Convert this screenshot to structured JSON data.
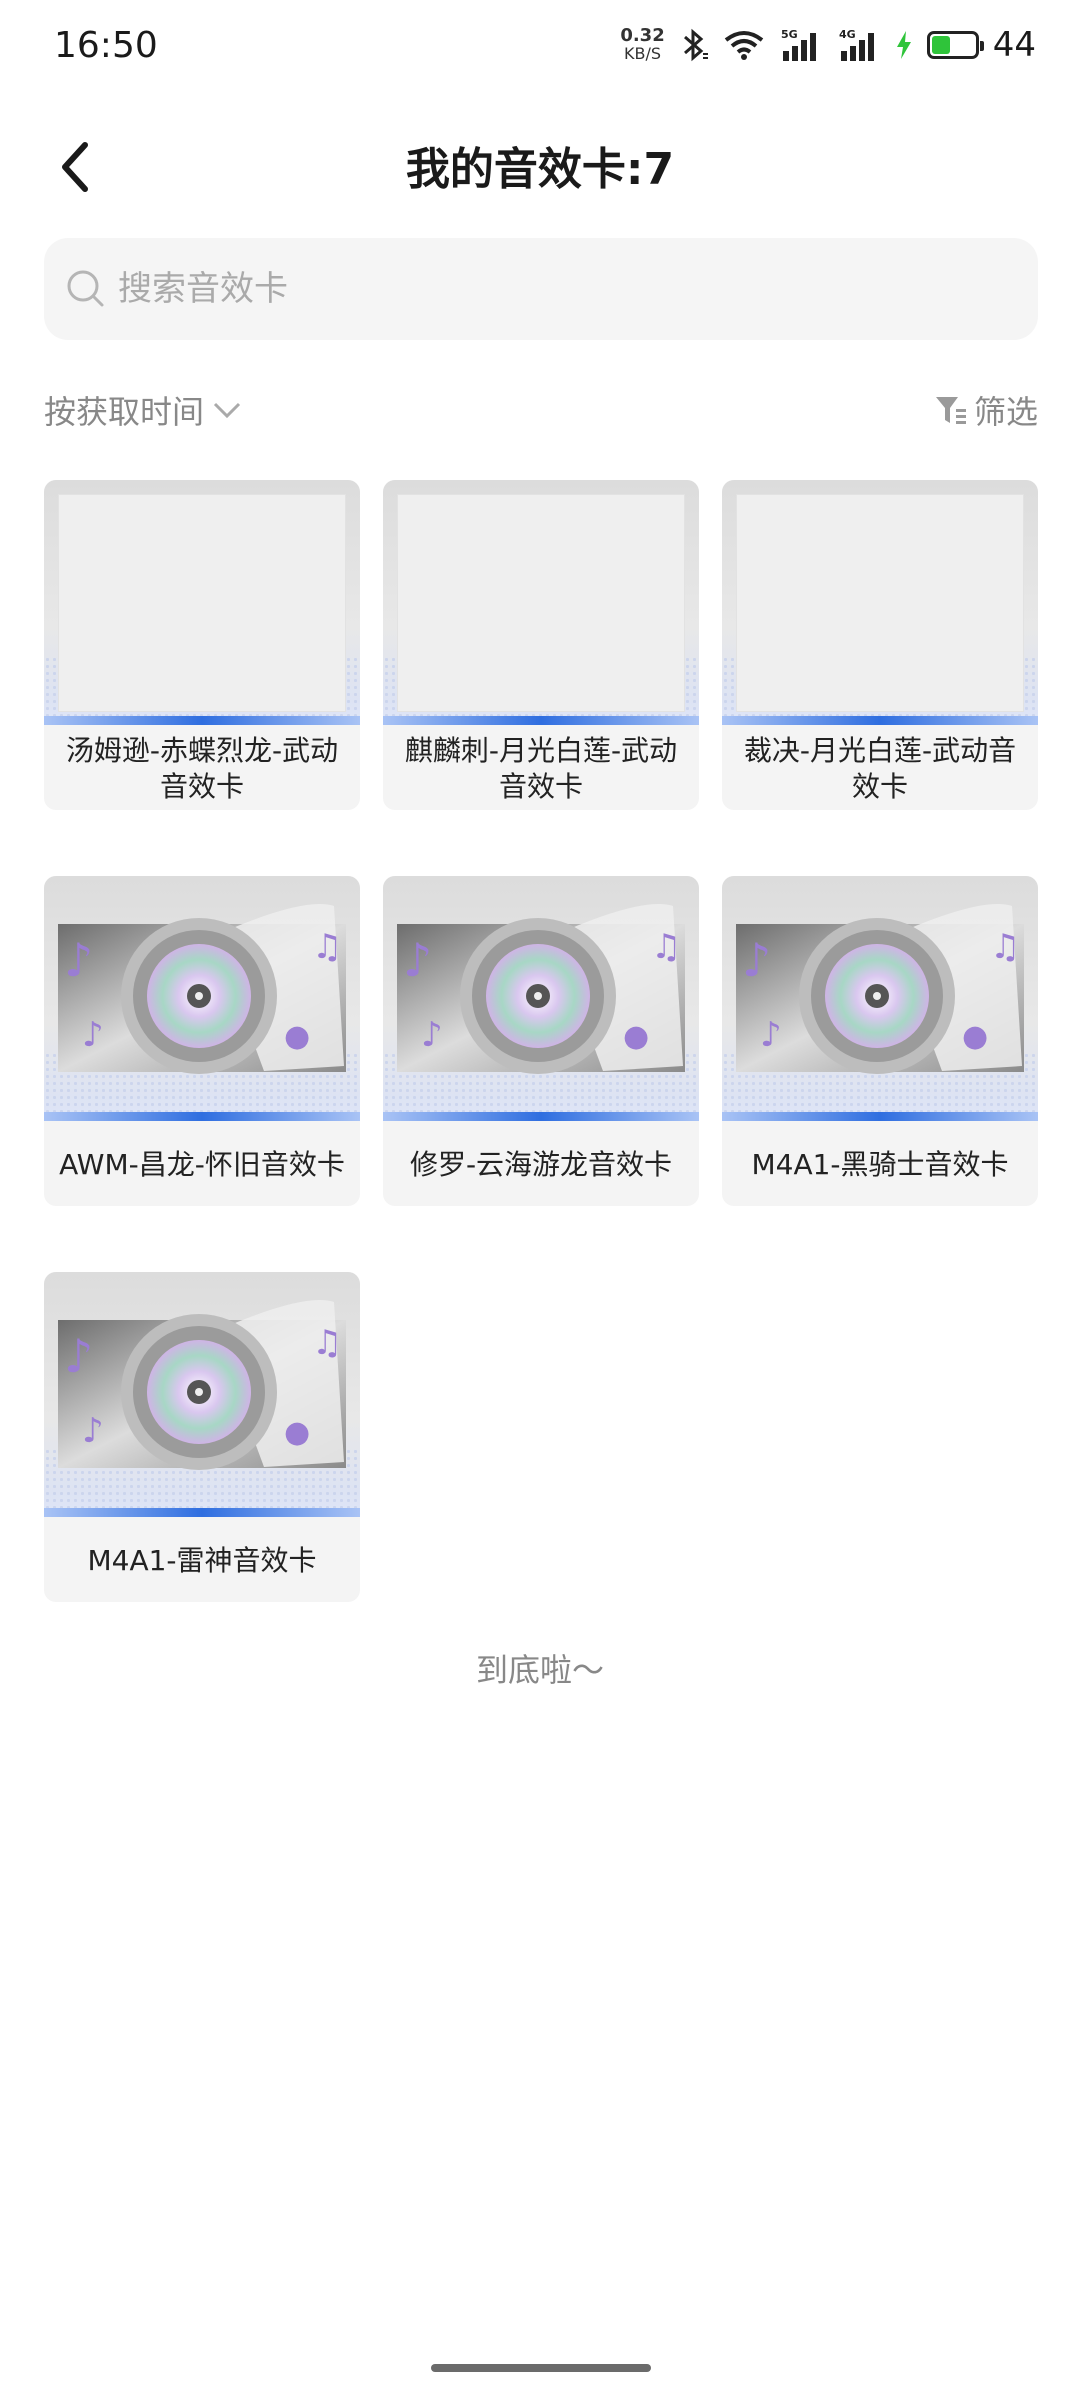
{
  "status_bar": {
    "time": "16:50",
    "net_speed_value": "0.32",
    "net_speed_unit": "KB/S",
    "signal1_label": "5G",
    "signal2_label": "4G",
    "battery_level": "44",
    "battery_color": "#2fc43a"
  },
  "header": {
    "title": "我的音效卡:7",
    "back_icon": "chevron-left-icon"
  },
  "search": {
    "placeholder": "搜索音效卡",
    "value": ""
  },
  "sort": {
    "label": "按获取时间",
    "icon": "chevron-down-icon"
  },
  "filter": {
    "label": "筛选",
    "icon": "filter-icon"
  },
  "cards": [
    {
      "label": "汤姆逊-赤蝶烈龙-武动音效卡",
      "image": "placeholder"
    },
    {
      "label": "麒麟刺-月光白莲-武动音效卡",
      "image": "placeholder"
    },
    {
      "label": "裁决-月光白莲-武动音效卡",
      "image": "placeholder"
    },
    {
      "label": "AWM-昌龙-怀旧音效卡",
      "image": "disc"
    },
    {
      "label": "修罗-云海游龙音效卡",
      "image": "disc"
    },
    {
      "label": "M4A1-黑骑士音效卡",
      "image": "disc"
    },
    {
      "label": "M4A1-雷神音效卡",
      "image": "disc"
    }
  ],
  "footer": {
    "end_text": "到底啦～"
  },
  "colors": {
    "accent_blue": "#2f6ee0",
    "card_bg": "#f4f4f4",
    "muted_text": "#888888"
  }
}
